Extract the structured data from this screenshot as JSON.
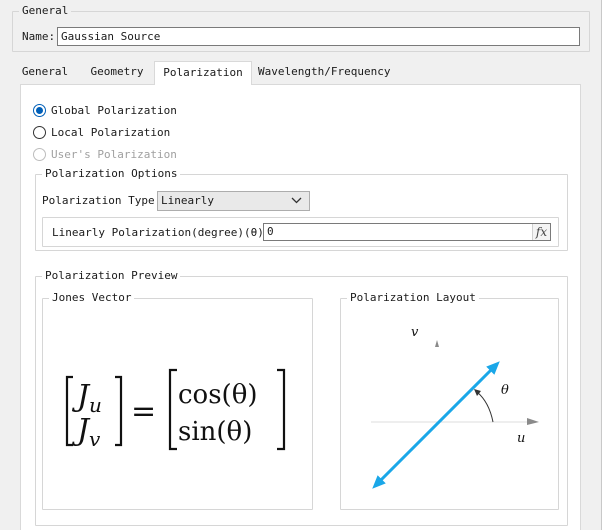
{
  "general": {
    "legend": "General",
    "name_label": "Name:",
    "name_value": "Gaussian Source"
  },
  "tabs": [
    {
      "label": "General",
      "active": false
    },
    {
      "label": "Geometry",
      "active": false
    },
    {
      "label": "Polarization",
      "active": true
    },
    {
      "label": "Wavelength/Frequency",
      "active": false
    }
  ],
  "polarization": {
    "radios": [
      {
        "label": "Global Polarization",
        "checked": true,
        "disabled": false
      },
      {
        "label": "Local Polarization",
        "checked": false,
        "disabled": false
      },
      {
        "label": "User's Polarization",
        "checked": false,
        "disabled": true
      }
    ],
    "options": {
      "legend": "Polarization Options",
      "type_label": "Polarization Type:",
      "type_value": "Linearly",
      "angle_label": "Linearly Polarization(degree)(θ):",
      "angle_value": "0",
      "fx_label": "fx"
    }
  },
  "preview": {
    "legend": "Polarization Preview",
    "jones": {
      "legend": "Jones Vector",
      "top_left": "J",
      "top_left_sub": "u",
      "bottom_left": "J",
      "bottom_left_sub": "v",
      "equals": "=",
      "top_right": "cos(θ)",
      "bottom_right": "sin(θ)"
    },
    "layout": {
      "legend": "Polarization Layout",
      "v_label": "v",
      "u_label": "u",
      "theta_label": "θ",
      "arrow_color": "#1aa7e8"
    }
  }
}
